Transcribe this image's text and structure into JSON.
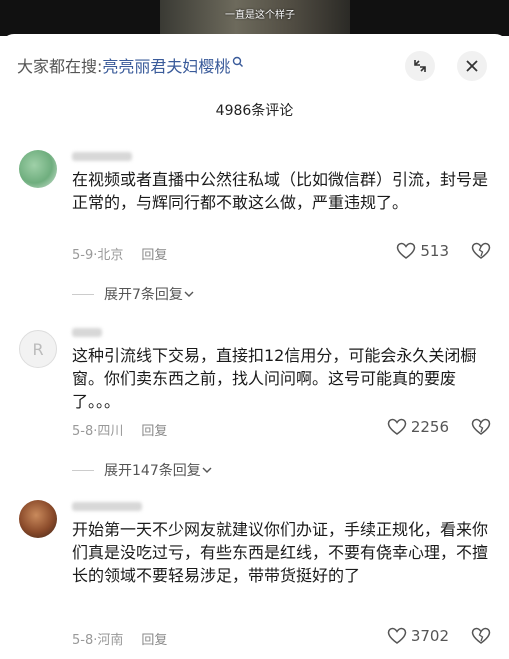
{
  "video": {
    "caption": "一直是这个样子"
  },
  "header": {
    "search_prefix": "大家都在搜:",
    "search_keyword": "亮亮丽君夫妇樱桃",
    "comment_count": "4986条评论"
  },
  "comments": [
    {
      "text": "在视频或者直播中公然往私域（比如微信群）引流，封号是正常的，与辉同行都不敢这么做，严重违规了。",
      "date": "5-9",
      "location": "北京",
      "reply_label": "回复",
      "likes": "513",
      "expand": "展开7条回复"
    },
    {
      "text": "这种引流线下交易，直接扣12信用分，可能会永久关闭橱窗。你们卖东西之前，找人问问啊。这号可能真的要废了。。。",
      "date": "5-8",
      "location": "四川",
      "reply_label": "回复",
      "likes": "2256",
      "expand": "展开147条回复"
    },
    {
      "text": "开始第一天不少网友就建议你们办证，手续正规化，看来你们真是没吃过亏，有些东西是红线，不要有侥幸心理，不擅长的领域不要轻易涉足，带带货挺好的了",
      "date": "5-8",
      "location": "河南",
      "reply_label": "回复",
      "likes": "3702"
    }
  ]
}
